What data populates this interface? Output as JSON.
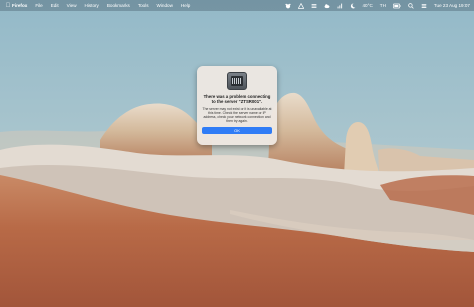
{
  "menubar": {
    "app_name": "Firefox",
    "menus": [
      "File",
      "Edit",
      "View",
      "History",
      "Bookmarks",
      "Tools",
      "Window",
      "Help"
    ],
    "status": {
      "temperature": "40°C",
      "input_source": "TH",
      "datetime": "Tue 23 Aug  19:07"
    },
    "icons": [
      "apple-icon",
      "bear-icon",
      "triangle-icon",
      "stack-icon",
      "cloud-icon",
      "bars-icon",
      "moon-icon",
      "battery-icon",
      "search-icon",
      "control-center-icon"
    ]
  },
  "dialog": {
    "title": "There was a problem connecting to the server \"ZTSR001\".",
    "message": "The server may not exist or it is unavailable at this time. Check the server name or IP address, check your network connection and then try again.",
    "ok_label": "OK"
  }
}
